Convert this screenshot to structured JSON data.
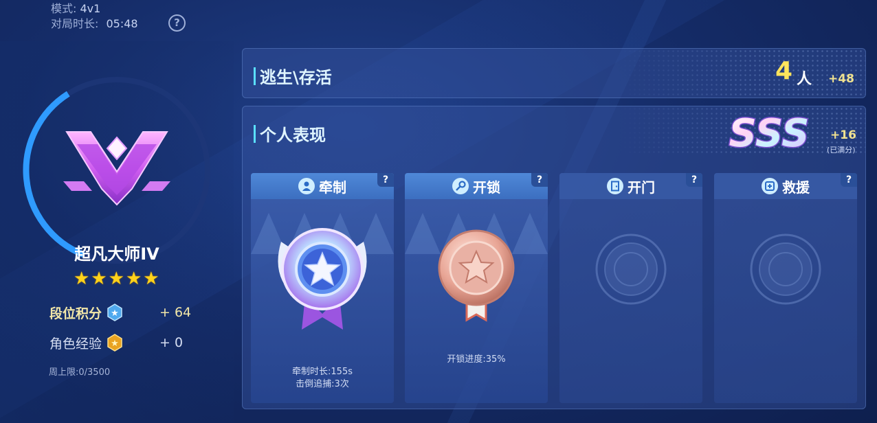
{
  "meta": {
    "mode_label": "模式:",
    "mode_value": "4v1",
    "duration_label": "对局时长:",
    "duration_value": "05:48",
    "help_icon": "question-circle-icon"
  },
  "rank": {
    "name": "超凡大师IV",
    "stars": [
      "★",
      "★",
      "★",
      "★",
      "★"
    ],
    "points_label": "段位积分",
    "points_value": "+ 64",
    "exp_label": "角色经验",
    "exp_value": "+ 0",
    "weekly_cap": "周上限:0/3500",
    "ring_progress": 0.35
  },
  "escape": {
    "title": "逃生\\存活",
    "count": "4",
    "unit": "人",
    "bonus": "+48"
  },
  "performance": {
    "title": "个人表现",
    "grade": "SSS",
    "bonus": "+16",
    "note": "(已满分)",
    "cards": [
      {
        "title": "牵制",
        "icon": "person-icon",
        "help": "?",
        "medal": "diamond-star-medal",
        "stat1": "牵制时长:155s",
        "stat2": "击倒追捕:3次"
      },
      {
        "title": "开锁",
        "icon": "key-icon",
        "help": "?",
        "medal": "bronze-star-medal",
        "stat1": "开锁进度:35%",
        "stat2": ""
      },
      {
        "title": "开门",
        "icon": "door-icon",
        "help": "?",
        "medal": "empty-slot",
        "stat1": "",
        "stat2": ""
      },
      {
        "title": "救援",
        "icon": "rescue-icon",
        "help": "?",
        "medal": "empty-slot",
        "stat1": "",
        "stat2": ""
      }
    ]
  },
  "colors": {
    "accent_cyan": "#5be0ff",
    "gold": "#ffe45c",
    "bonus": "#f0e290"
  }
}
